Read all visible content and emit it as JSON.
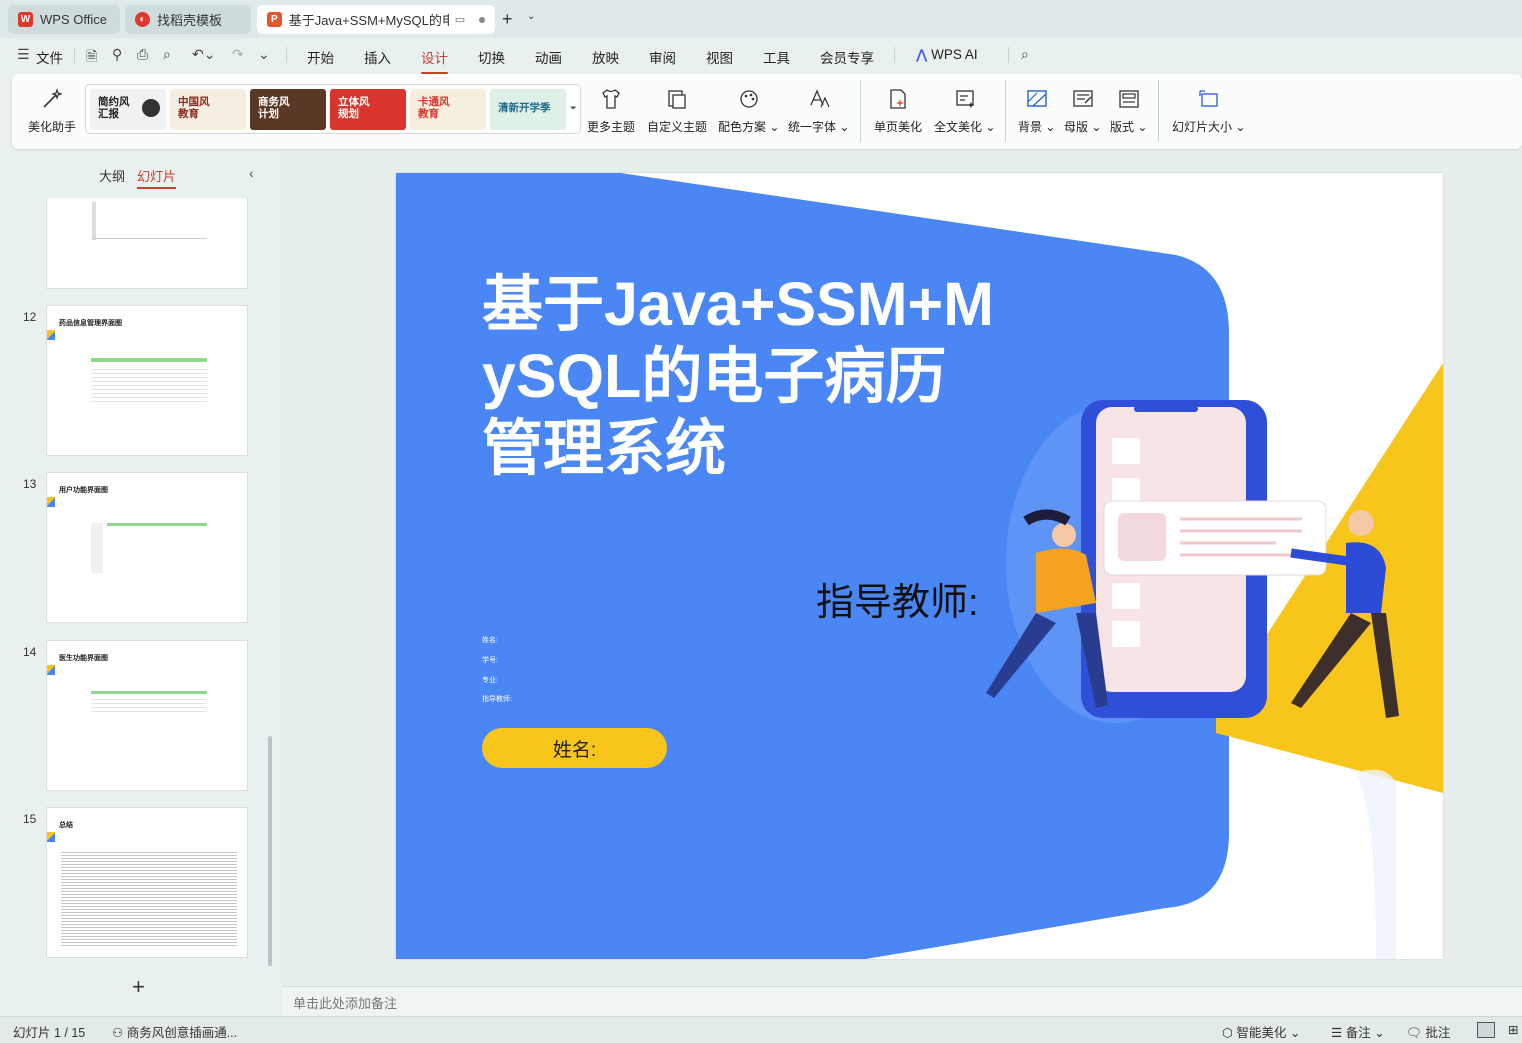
{
  "tabs": [
    {
      "label": "WPS Office"
    },
    {
      "label": "找稻壳模板"
    },
    {
      "label": "基于Java+SSM+MySQL的电"
    }
  ],
  "menu": {
    "file": "文件",
    "items": [
      "开始",
      "插入",
      "设计",
      "切换",
      "动画",
      "放映",
      "审阅",
      "视图",
      "工具",
      "会员专享"
    ],
    "active": "设计",
    "wps_ai": "WPS AI"
  },
  "ribbon": {
    "beautify_assistant": "美化助手",
    "themes": [
      {
        "label": "简约风\n汇报"
      },
      {
        "label": "中国风\n教育"
      },
      {
        "label": "商务风\n计划"
      },
      {
        "label": "立体风\n规划"
      },
      {
        "label": "卡通风\n教育"
      },
      {
        "label": "清新开学季"
      }
    ],
    "buttons": [
      "更多主题",
      "自定义主题",
      "配色方案",
      "统一字体",
      "单页美化",
      "全文美化",
      "背景",
      "母版",
      "版式",
      "幻灯片大小"
    ]
  },
  "panel": {
    "outline_tab": "大纲",
    "slides_tab": "幻灯片",
    "thumbs": [
      {
        "num": "12",
        "title": "药品信息管理界面图"
      },
      {
        "num": "13",
        "title": "用户功能界面图"
      },
      {
        "num": "14",
        "title": "医生功能界面图"
      },
      {
        "num": "15",
        "title": "总结"
      }
    ]
  },
  "slide": {
    "title": "基于Java+SSM+MySQL的电子病历管理系统",
    "advisor": "指导教师:",
    "info": [
      "姓名:",
      "学号:",
      "专业:",
      "指导教师:"
    ],
    "name_pill": "姓名:",
    "colors": {
      "blue": "#4a86f4",
      "yellow": "#f8c51a"
    }
  },
  "notes_placeholder": "单击此处添加备注",
  "status": {
    "slide_counter": "幻灯片 1 / 15",
    "theme_name": "商务风创意插画通...",
    "smart_beautify": "智能美化",
    "notes": "备注",
    "comments": "批注"
  }
}
